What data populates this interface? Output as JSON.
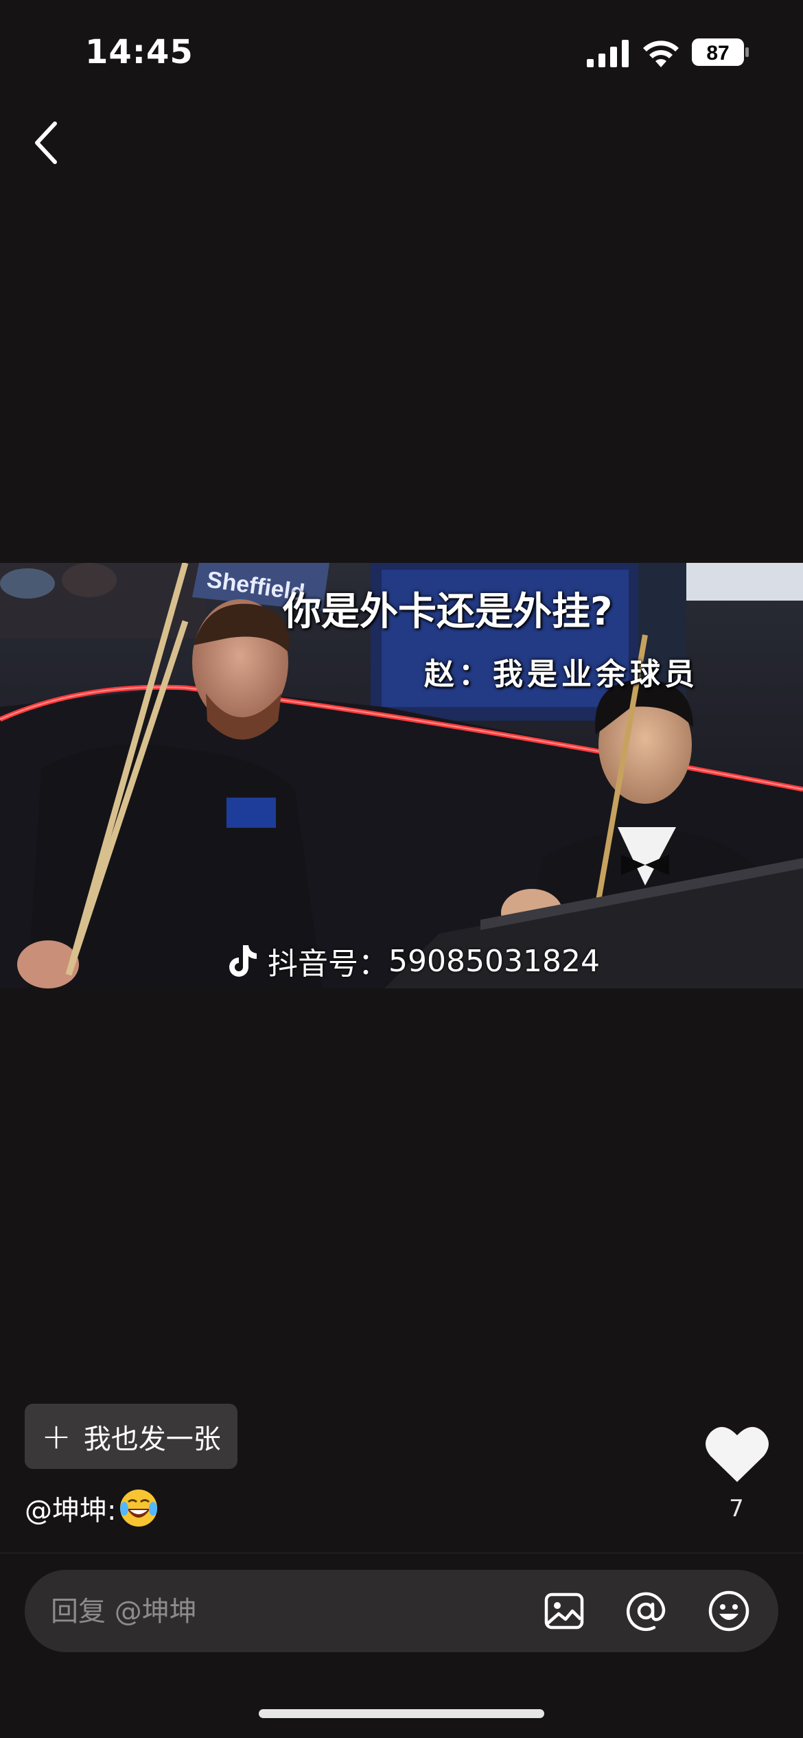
{
  "status_bar": {
    "time": "14:45",
    "battery": "87"
  },
  "photo": {
    "caption_line1": "你是外卡还是外挂?",
    "caption_line2": "赵：我是业余球员",
    "watermark_label": "抖音号：",
    "watermark_id": "59085031824",
    "background_sign_text": "Sheffield"
  },
  "actions": {
    "post_button_label": "我也发一张"
  },
  "comment": {
    "author": "@坤坤:",
    "emoji": "laughing-crying-emoji"
  },
  "like": {
    "count": "7"
  },
  "reply": {
    "placeholder": "回复 @坤坤"
  },
  "icons": [
    "back-icon",
    "signal-icon",
    "wifi-icon",
    "battery-icon",
    "tiktok-logo-icon",
    "plus-icon",
    "heart-icon",
    "image-icon",
    "at-icon",
    "emoji-icon"
  ],
  "colors": {
    "background": "#161315",
    "button_bg": "#3a3839",
    "reply_bar": "#2f2c2e",
    "neon_red": "#ff3b3b"
  }
}
